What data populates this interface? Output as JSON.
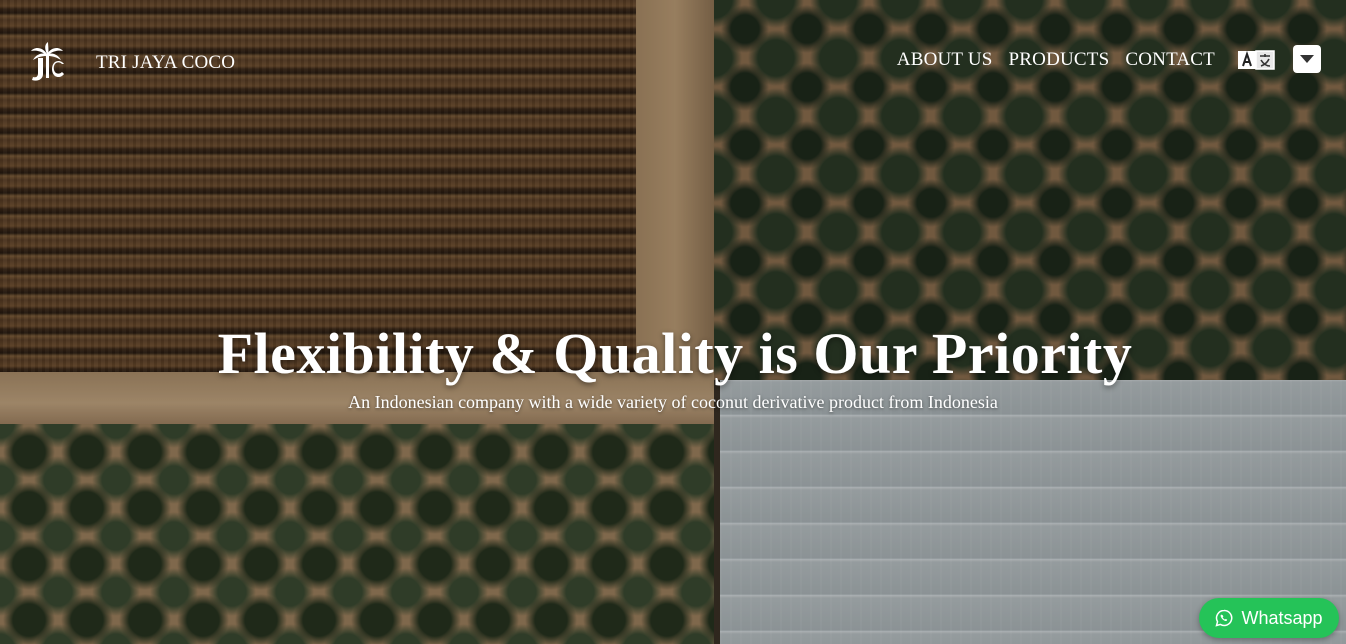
{
  "brand": {
    "logo_icon": "palm-tree-jc-logo",
    "name": "TRI JAYA COCO"
  },
  "nav": {
    "items": [
      {
        "label": "ABOUT US"
      },
      {
        "label": "PRODUCTS"
      },
      {
        "label": "CONTACT"
      }
    ],
    "language_icon": "translate-icon",
    "dropdown_icon": "chevron-down-icon"
  },
  "hero": {
    "title": "Flexibility & Quality is Our Priority",
    "subtitle": "An Indonesian company with a wide variety of coconut derivative product from Indonesia"
  },
  "whatsapp": {
    "label": "Whatsapp",
    "icon": "whatsapp-icon",
    "color": "#25c358"
  }
}
